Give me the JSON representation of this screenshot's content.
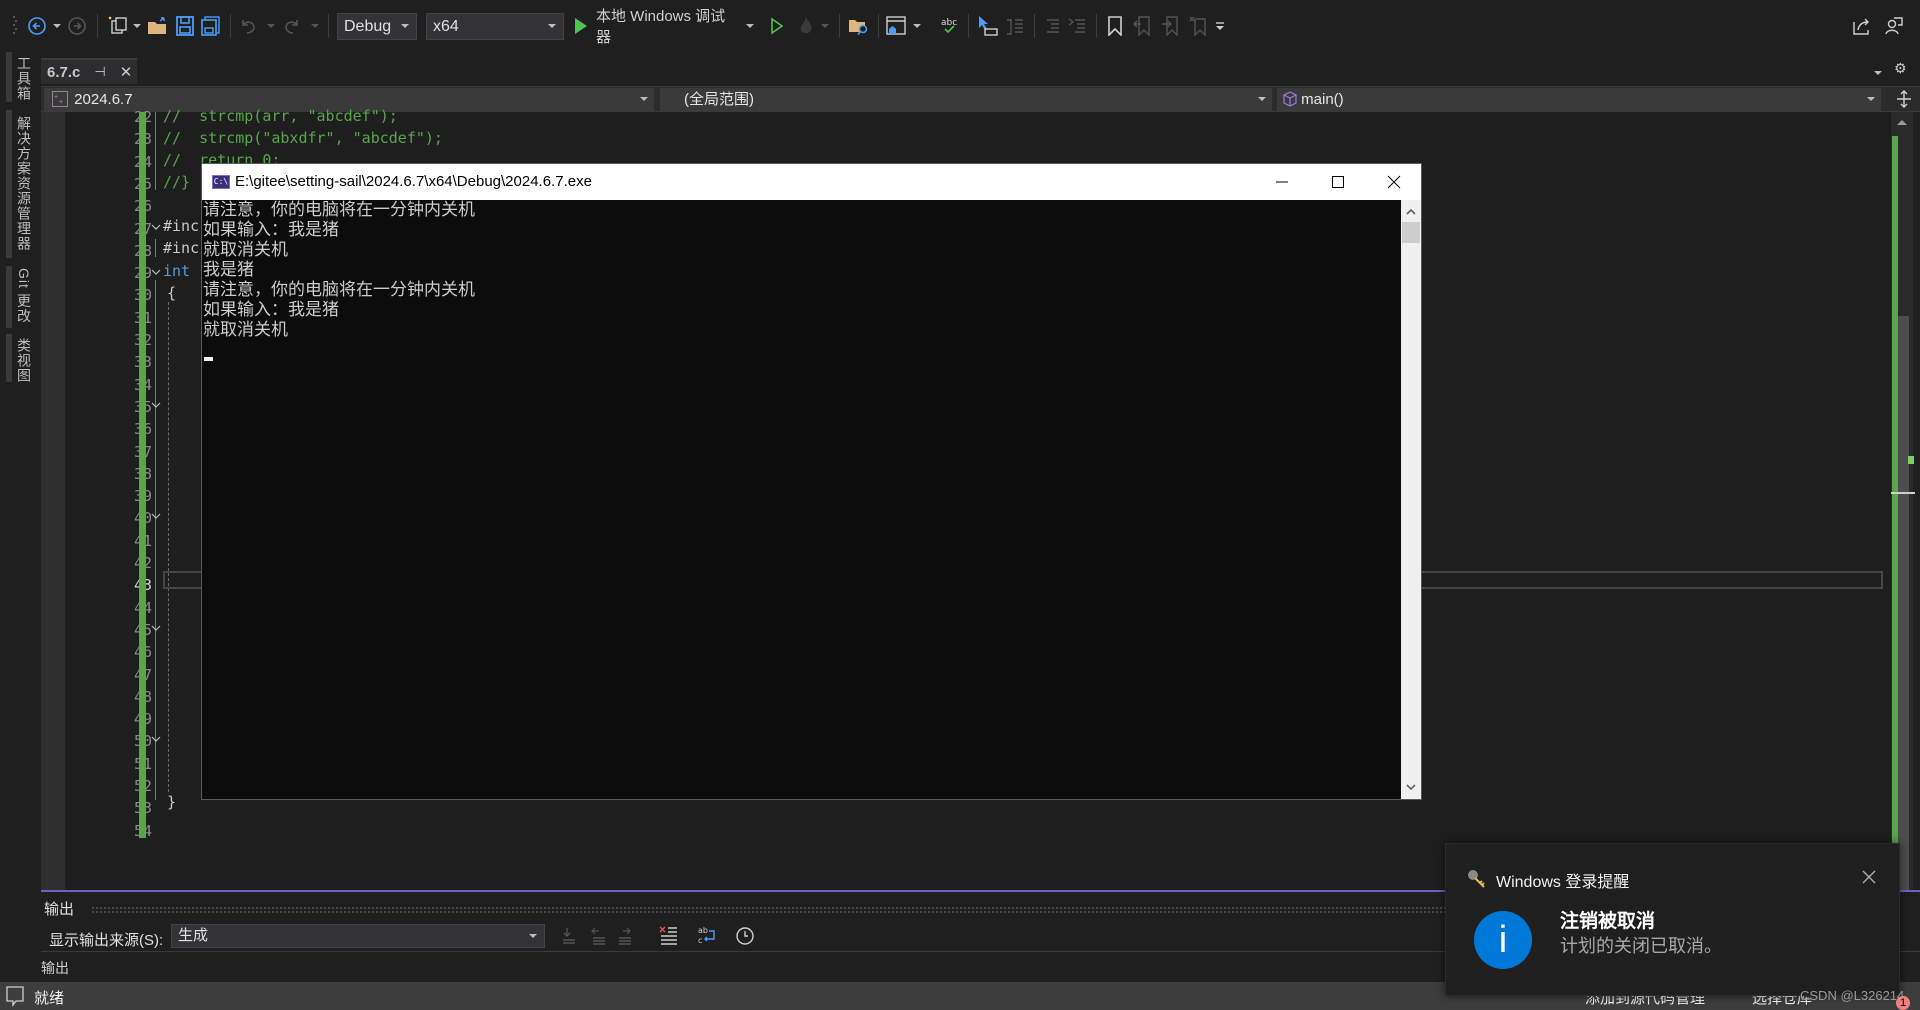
{
  "toolbar": {
    "config": "Debug",
    "platform": "x64",
    "run_label": "本地 Windows 调试器"
  },
  "side_tabs": [
    "工具箱",
    "解决方案资源管理器",
    "Git 更改",
    "类视图"
  ],
  "doc_tab": {
    "name": "6.7.c"
  },
  "navbar": {
    "project": "2024.6.7",
    "scope": "(全局范围)",
    "member": "main()"
  },
  "editor": {
    "line_numbers": [
      "22",
      "23",
      "24",
      "25",
      "26",
      "27",
      "28",
      "29",
      "30",
      "31",
      "32",
      "33",
      "34",
      "35",
      "36",
      "37",
      "38",
      "39",
      "40",
      "41",
      "42",
      "43",
      "44",
      "45",
      "46",
      "47",
      "48",
      "49",
      "50",
      "51",
      "52",
      "53",
      "54"
    ],
    "active_line": "43",
    "code_lines": {
      "l22": "//  strcmp(arr, \"abcdef\");",
      "l23": "//  strcmp(\"abxdfr\", \"abcdef\");",
      "l24": "//  return 0;",
      "l25": "//}",
      "l27": "#inc",
      "l28": "#inc",
      "l29_kw": "int",
      "l30": "{",
      "l53": "}"
    }
  },
  "console": {
    "title": "E:\\gitee\\setting-sail\\2024.6.7\\x64\\Debug\\2024.6.7.exe",
    "lines": [
      "请注意，你的电脑将在一分钟内关机",
      "如果输入：我是猪",
      "就取消关机",
      "我是猪",
      "请注意，你的电脑将在一分钟内关机",
      "如果输入：我是猪",
      "就取消关机"
    ]
  },
  "output": {
    "title": "输出",
    "source_label": "显示输出来源(S):",
    "source_value": "生成",
    "sub_label": "输出"
  },
  "status": {
    "text": "就绪",
    "git_add": "添加到源代码管理",
    "repo": "选择仓库",
    "notifications_count": "1"
  },
  "toast": {
    "app": "Windows 登录提醒",
    "heading": "注销被取消",
    "body": "计划的关闭已取消。"
  },
  "watermark": "CSDN @L326214"
}
